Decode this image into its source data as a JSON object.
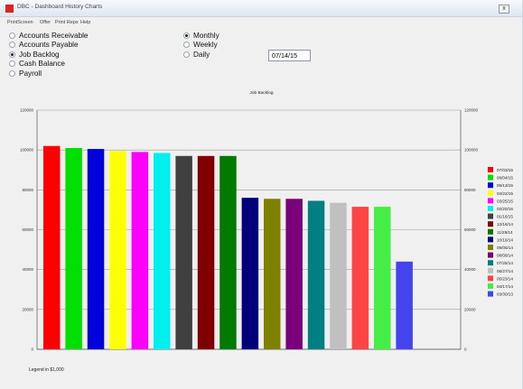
{
  "window": {
    "title": "DBC - Dashboard History Charts",
    "close_label": "x"
  },
  "menu": [
    "PrintScreen",
    "Offer",
    "Print Reps",
    "Help"
  ],
  "report_options": [
    {
      "label": "Accounts Receivable",
      "checked": false
    },
    {
      "label": "Accounts Payable",
      "checked": false
    },
    {
      "label": "Job Backlog",
      "checked": true
    },
    {
      "label": "Cash Balance",
      "checked": false
    },
    {
      "label": "Payroll",
      "checked": false
    }
  ],
  "period_options": [
    {
      "label": "Monthly",
      "checked": true
    },
    {
      "label": "Weekly",
      "checked": false
    },
    {
      "label": "Daily",
      "checked": false
    }
  ],
  "date_value": "07/14/15",
  "legend_note": "Legend in $1,000",
  "chart_data": {
    "type": "bar",
    "title": "Job Backlog",
    "categories": [
      "07/03/15",
      "06/04/15",
      "05/13/15",
      "04/22/15",
      "03/25/15",
      "02/20/15",
      "01/16/15",
      "12/16/14",
      "11/26/14",
      "10/16/14",
      "09/05/14",
      "08/08/14",
      "07/25/14",
      "06/27/14",
      "05/23/14",
      "04/17/14",
      "03/30/13"
    ],
    "values": [
      102000,
      101000,
      100500,
      99500,
      99000,
      98500,
      97000,
      97000,
      97000,
      76000,
      75500,
      75500,
      74500,
      73500,
      71500,
      71500,
      44000
    ],
    "colors": [
      "#ff0000",
      "#00e000",
      "#0000dd",
      "#ffff00",
      "#ff00ff",
      "#00f0f0",
      "#404040",
      "#800000",
      "#007a00",
      "#00007a",
      "#808000",
      "#7a007a",
      "#008080",
      "#c0c0c0",
      "#ff4444",
      "#44ee44",
      "#4444ee"
    ],
    "ylim": [
      0,
      120000
    ],
    "yticks": [
      "0",
      "20000",
      "40000",
      "60000",
      "80000",
      "100000",
      "120000"
    ],
    "grid": true,
    "legend_position": "right"
  }
}
